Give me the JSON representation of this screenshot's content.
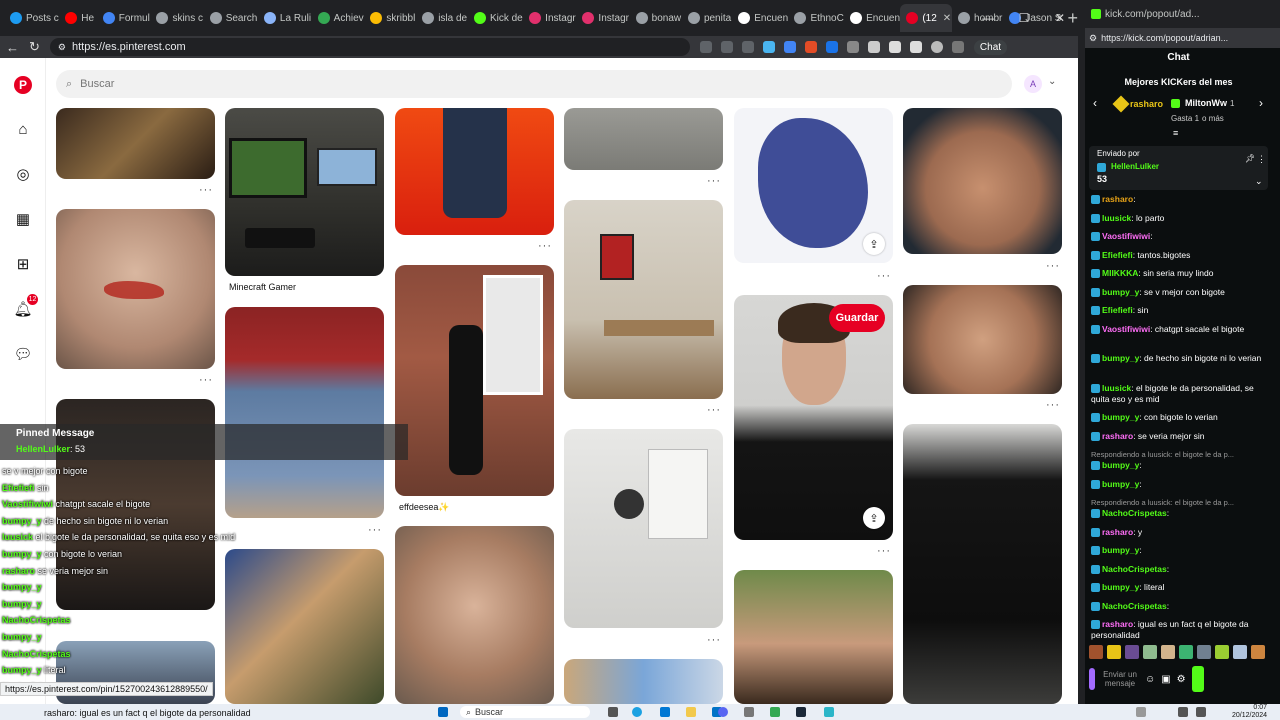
{
  "browser": {
    "tabs": [
      {
        "label": "Posts c",
        "color": "#1d9bf0"
      },
      {
        "label": "He",
        "color": "#ff0000"
      },
      {
        "label": "Formul",
        "color": "#4285f4"
      },
      {
        "label": "skins c",
        "color": "#9aa0a6"
      },
      {
        "label": "Search",
        "color": "#9aa0a6"
      },
      {
        "label": "La Ruli",
        "color": "#8ab4f8"
      },
      {
        "label": "Achiev",
        "color": "#34a853"
      },
      {
        "label": "skribbl",
        "color": "#fbbc04"
      },
      {
        "label": "isla de",
        "color": "#9aa0a6"
      },
      {
        "label": "Kick de",
        "color": "#53fc18"
      },
      {
        "label": "Instagr",
        "color": "#e1306c"
      },
      {
        "label": "Instagr",
        "color": "#e1306c"
      },
      {
        "label": "bonaw",
        "color": "#9aa0a6"
      },
      {
        "label": "penita",
        "color": "#9aa0a6"
      },
      {
        "label": "Encuen",
        "color": "#ffffff"
      },
      {
        "label": "EthnoC",
        "color": "#9aa0a6"
      },
      {
        "label": "Encuen",
        "color": "#ffffff"
      },
      {
        "label": "(12",
        "color": "#e60023"
      },
      {
        "label": "hombr",
        "color": "#9aa0a6"
      },
      {
        "label": "Jason S",
        "color": "#4285f4"
      }
    ],
    "url": "https://es.pinterest.com",
    "chat_btn": "Chat",
    "status_url": "https://es.pinterest.com/pin/152700243612889550/"
  },
  "pinterest": {
    "search_placeholder": "Buscar",
    "avatar_letter": "A",
    "notifications_count": "12",
    "save_label": "Guardar",
    "pin_titles": {
      "minecraft": "Minecraft Gamer",
      "effdeesea": "effdeesea✨"
    },
    "more": "···"
  },
  "overlay": {
    "title": "Pinned Message",
    "pinned_author": "HellenLulker",
    "pinned_value": ": 53",
    "lines": [
      {
        "user": "",
        "text": "se v mejor con bigote"
      },
      {
        "user": "Efiefiefi",
        "text": " sin"
      },
      {
        "user": "Vaostifiwiwi",
        "text": " chatgpt sacale el bigote"
      },
      {
        "user": "bumpy_y",
        "text": " de hecho sin bigote ni lo verian"
      },
      {
        "user": "luusick",
        "text": " el bigote le da personalidad, se quita eso y es mid"
      },
      {
        "user": "bumpy_y",
        "text": " con bigote lo verian"
      },
      {
        "user": "rasharo",
        "text": " se veria mejor sin"
      },
      {
        "user": "bumpy_y",
        "text": ""
      },
      {
        "user": "bumpy_y",
        "text": ""
      },
      {
        "user": "NachoCrispetas",
        "text": ""
      },
      {
        "user": "bumpy_y",
        "text": ""
      },
      {
        "user": "NachoCrispetas",
        "text": ""
      },
      {
        "user": "bumpy_y",
        "text": " literal"
      },
      {
        "user": "NachoCrispetas",
        "text": ""
      }
    ]
  },
  "chat": {
    "window_title": "kick.com/popout/ad...",
    "url": "https://kick.com/popout/adrian...",
    "title": "Chat",
    "top_label": "Mejores KICKers del mes",
    "kicker1": {
      "name": "rasharo",
      "amount": "1"
    },
    "kicker2": {
      "name": "MiltonWw",
      "amount": "1"
    },
    "gift_line": "Gasta 1",
    "gift_more": "o más",
    "sent_by": "Enviado por",
    "pinned_author": "HellenLulker",
    "pinned_text": "53",
    "messages": [
      {
        "user": "rasharo",
        "color": "#e8a317",
        "text": ":",
        "reply": ""
      },
      {
        "user": "luusick",
        "color": "#53fc18",
        "text": ": lo parto",
        "reply": ""
      },
      {
        "user": "Vaostifiwiwi",
        "color": "#ff6ef7",
        "text": ":",
        "reply": ""
      },
      {
        "user": "Efiefiefi",
        "color": "#53fc18",
        "text": ": tantos.bigotes",
        "reply": ""
      },
      {
        "user": "MIIKKKA",
        "color": "#53fc18",
        "text": ": sin seria muy lindo",
        "reply": ""
      },
      {
        "user": "bumpy_y",
        "color": "#53fc18",
        "text": ": se v mejor con bigote",
        "reply": ""
      },
      {
        "user": "Efiefiefi",
        "color": "#53fc18",
        "text": ": sin",
        "reply": ""
      },
      {
        "user": "Vaostifiwiwi",
        "color": "#ff6ef7",
        "text": ": chatgpt sacale el bigote",
        "reply": ""
      },
      {
        "user": "bumpy_y",
        "color": "#53fc18",
        "text": ": de hecho sin bigote ni lo verian",
        "reply": ""
      },
      {
        "user": "luusick",
        "color": "#53fc18",
        "text": ": el bigote le da personalidad, se quita eso y es mid",
        "reply": ""
      },
      {
        "user": "bumpy_y",
        "color": "#53fc18",
        "text": ": con bigote lo verian",
        "reply": ""
      },
      {
        "user": "rasharo",
        "color": "#ff6ef7",
        "text": ": se veria mejor sin",
        "reply": ""
      },
      {
        "user": "bumpy_y",
        "color": "#53fc18",
        "text": ":",
        "reply": "Respondiendo a luusick: el bigote le da p..."
      },
      {
        "user": "bumpy_y",
        "color": "#53fc18",
        "text": ":",
        "reply": ""
      },
      {
        "user": "NachoCrispetas",
        "color": "#53fc18",
        "text": ":",
        "reply": "Respondiendo a luusick: el bigote le da p..."
      },
      {
        "user": "rasharo",
        "color": "#ff6ef7",
        "text": ": y",
        "reply": ""
      },
      {
        "user": "bumpy_y",
        "color": "#53fc18",
        "text": ":",
        "reply": ""
      },
      {
        "user": "NachoCrispetas",
        "color": "#53fc18",
        "text": ":",
        "reply": ""
      },
      {
        "user": "bumpy_y",
        "color": "#53fc18",
        "text": ": literal",
        "reply": ""
      },
      {
        "user": "NachoCrispetas",
        "color": "#53fc18",
        "text": ":",
        "reply": ""
      },
      {
        "user": "rasharo",
        "color": "#ff6ef7",
        "text": ": igual es un fact q el bigote da personalidad",
        "reply": ""
      }
    ],
    "send_placeholder": "Enviar un mensaje"
  },
  "taskbar": {
    "search": "Buscar",
    "caption": "rasharo: igual es un fact q el bigote da personalidad",
    "time": "0:07",
    "date": "20/12/2024"
  }
}
